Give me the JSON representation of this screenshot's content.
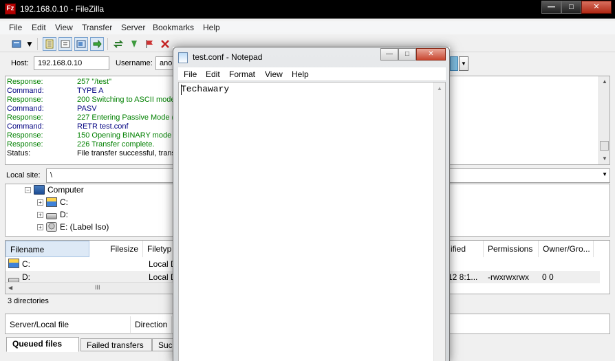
{
  "filezilla": {
    "window_title": "192.168.0.10 - FileZilla",
    "app_icon": "Fz",
    "menu": [
      "File",
      "Edit",
      "View",
      "Transfer",
      "Server",
      "Bookmarks",
      "Help"
    ],
    "quickconnect": {
      "host_label": "Host:",
      "host_value": "192.168.0.10",
      "username_label": "Username:",
      "username_value": "anon"
    },
    "log": [
      {
        "k": "Response:",
        "v": "257 \"/test\"",
        "t": "resp"
      },
      {
        "k": "Command:",
        "v": "TYPE A",
        "t": "cmd"
      },
      {
        "k": "Response:",
        "v": "200 Switching to ASCII mode",
        "t": "resp"
      },
      {
        "k": "Command:",
        "v": "PASV",
        "t": "cmd"
      },
      {
        "k": "Response:",
        "v": "227 Entering Passive Mode (1",
        "t": "resp"
      },
      {
        "k": "Command:",
        "v": "RETR test.conf",
        "t": "cmd"
      },
      {
        "k": "Response:",
        "v": "150 Opening BINARY mode da",
        "t": "resp"
      },
      {
        "k": "Response:",
        "v": "226 Transfer complete.",
        "t": "resp"
      },
      {
        "k": "Status:",
        "v": "File transfer successful, trans",
        "t": "stat"
      }
    ],
    "local_site": {
      "label": "Local site:",
      "path": "\\"
    },
    "tree": {
      "computer": "Computer",
      "drives": [
        "C:",
        "D:",
        "E: (Label Iso)"
      ]
    },
    "file_columns": {
      "filename": "Filename",
      "filesize": "Filesize",
      "filetype": "Filetyp",
      "modified": "ified",
      "permissions": "Permissions",
      "owner": "Owner/Gro..."
    },
    "local_files": [
      {
        "name": "C:",
        "type": "Local D"
      },
      {
        "name": "D:",
        "type": "Local D"
      }
    ],
    "remote_row": {
      "modified": "12 8:1...",
      "permissions": "-rwxrwxrwx",
      "owner": "0 0"
    },
    "hscroll_label": "III",
    "status_text": "3 directories",
    "queue_columns": {
      "server_file": "Server/Local file",
      "direction": "Direction"
    },
    "queue_tabs": [
      "Queued files",
      "Failed transfers",
      "Succ"
    ]
  },
  "notepad": {
    "window_title": "test.conf - Notepad",
    "menu": [
      "File",
      "Edit",
      "Format",
      "View",
      "Help"
    ],
    "content": "Techawary"
  },
  "colors": {
    "log_response": "#008000",
    "log_command": "#000080",
    "titlebar": "#000000",
    "close_button": "#c8462f"
  }
}
